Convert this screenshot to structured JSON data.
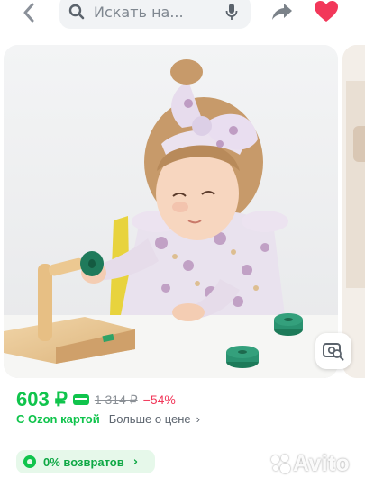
{
  "topbar": {
    "back_icon": "chevron-left-icon",
    "search": {
      "placeholder": "Искать на...",
      "search_icon": "search-icon",
      "mic_icon": "microphone-icon"
    },
    "share_icon": "share-icon",
    "favorite_icon": "heart-icon",
    "favorite_color": "#f2385a"
  },
  "gallery": {
    "photo_search_icon": "image-search-icon"
  },
  "price": {
    "current": "603 ₽",
    "card_icon": "bank-card-icon",
    "old": "1 314 ₽",
    "discount": "−54%",
    "accent": "#10c44c",
    "discount_color": "#f2385a"
  },
  "ozon": {
    "card_label": "С Ozon картой",
    "more_label": "Больше о цене",
    "chevron": "›"
  },
  "returns": {
    "icon": "returns-icon",
    "label": "0% возвратов",
    "chevron": "›"
  },
  "watermark": {
    "text": "Avito"
  }
}
